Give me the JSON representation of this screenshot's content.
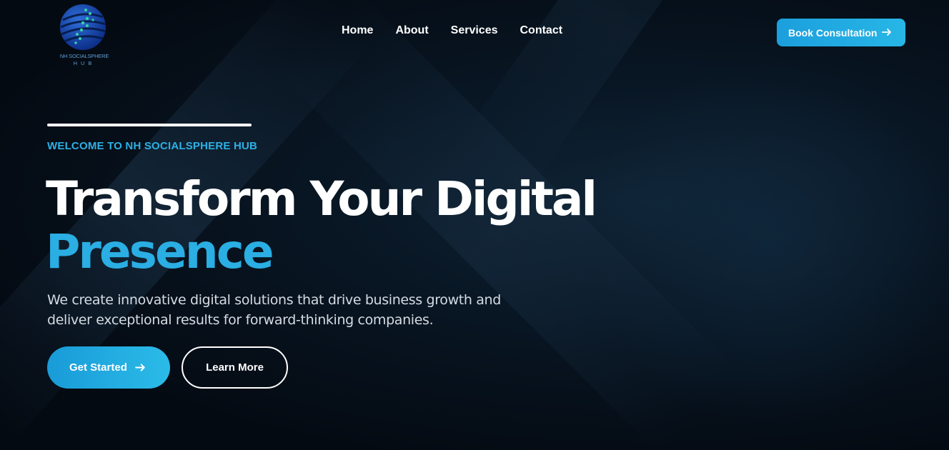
{
  "brand": {
    "logo_icon": "globe-dots-icon",
    "logo_line1": "NH SOCIALSPHERE",
    "logo_line2": "HUB"
  },
  "nav": {
    "items": [
      {
        "label": "Home"
      },
      {
        "label": "About"
      },
      {
        "label": "Services"
      },
      {
        "label": "Contact"
      }
    ]
  },
  "header": {
    "cta_label": "Book Consultation",
    "cta_icon": "arrow-right-icon"
  },
  "hero": {
    "eyebrow": "WELCOME TO NH SOCIALSPHERE HUB",
    "title_line1": "Transform Your Digital",
    "title_line2": "Presence",
    "description": "We create innovative digital solutions that drive business growth and deliver exceptional results for forward-thinking companies.",
    "primary_cta": "Get Started",
    "primary_cta_icon": "arrow-right-icon",
    "secondary_cta": "Learn More"
  },
  "colors": {
    "background": "#050d17",
    "accent": "#2aaee3",
    "text": "#ffffff",
    "muted_text": "#d4dbe3"
  }
}
